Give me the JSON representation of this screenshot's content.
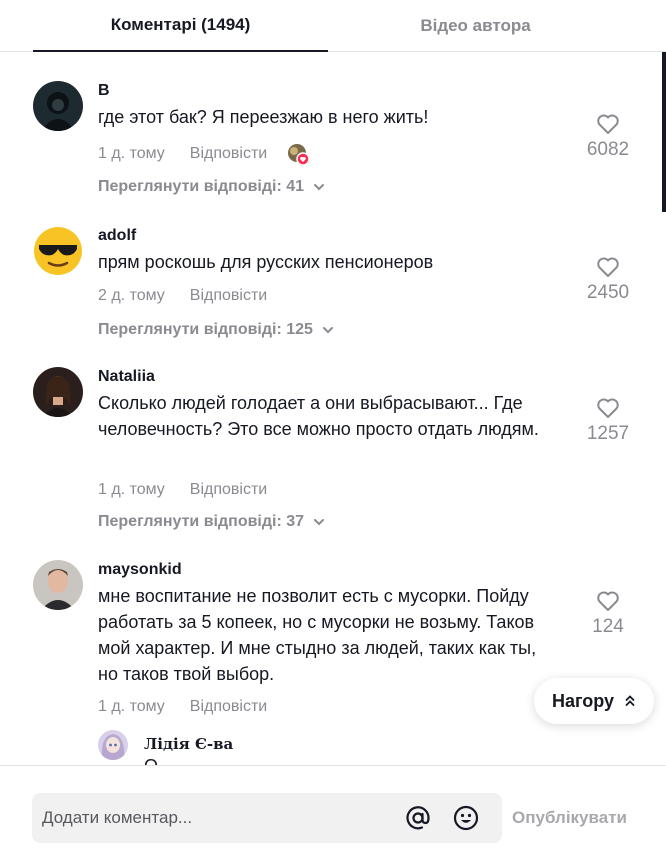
{
  "tabs": {
    "comments_label": "Коментарі (1494)",
    "author_videos_label": "Відео автора"
  },
  "comments": [
    {
      "username": "В",
      "text": "где этот бак? Я переезжаю в него жить!",
      "time": "1 д. тому",
      "reply_label": "Відповісти",
      "likes": "6082",
      "view_replies": "Переглянути відповіді: 41",
      "avatar_icon": "dark-hooded-figure-avatar",
      "creator_liked": true
    },
    {
      "username": "adolf",
      "text": "прям роскошь для русских пенсионеров",
      "time": "2 д. тому",
      "reply_label": "Відповісти",
      "likes": "2450",
      "view_replies": "Переглянути відповіді: 125",
      "avatar_icon": "sunglasses-emoji-avatar"
    },
    {
      "username": "Nataliia",
      "text": "Сколько людей голодает а они выбрасывают... Где человечность? Это все можно просто отдать людям.",
      "time": "1 д. тому",
      "reply_label": "Відповісти",
      "likes": "1257",
      "view_replies": "Переглянути відповіді: 37",
      "avatar_icon": "woman-portrait-avatar"
    },
    {
      "username": "maysonkid",
      "text": "мне воспитание не позволит есть с мусорки. Пойду работать за 5 копеек, но с мусорки не возьму. Таков мой характер. И мне стыдно за людей, таких как ты, но таков твой выбор.",
      "time": "1 д. тому",
      "reply_label": "Відповісти",
      "likes": "124",
      "avatar_icon": "man-portrait-avatar"
    }
  ],
  "reply": {
    "username": "Лідія Є-ва",
    "text": "О",
    "avatar_icon": "anime-girl-avatar"
  },
  "to_top": {
    "label": "Нагору"
  },
  "footer": {
    "input_placeholder": "Додати коментар...",
    "post_label": "Опублікувати"
  },
  "colors": {
    "text": "#161823",
    "secondary": "#8a8b91",
    "creator_heart": "#fe2c55"
  }
}
